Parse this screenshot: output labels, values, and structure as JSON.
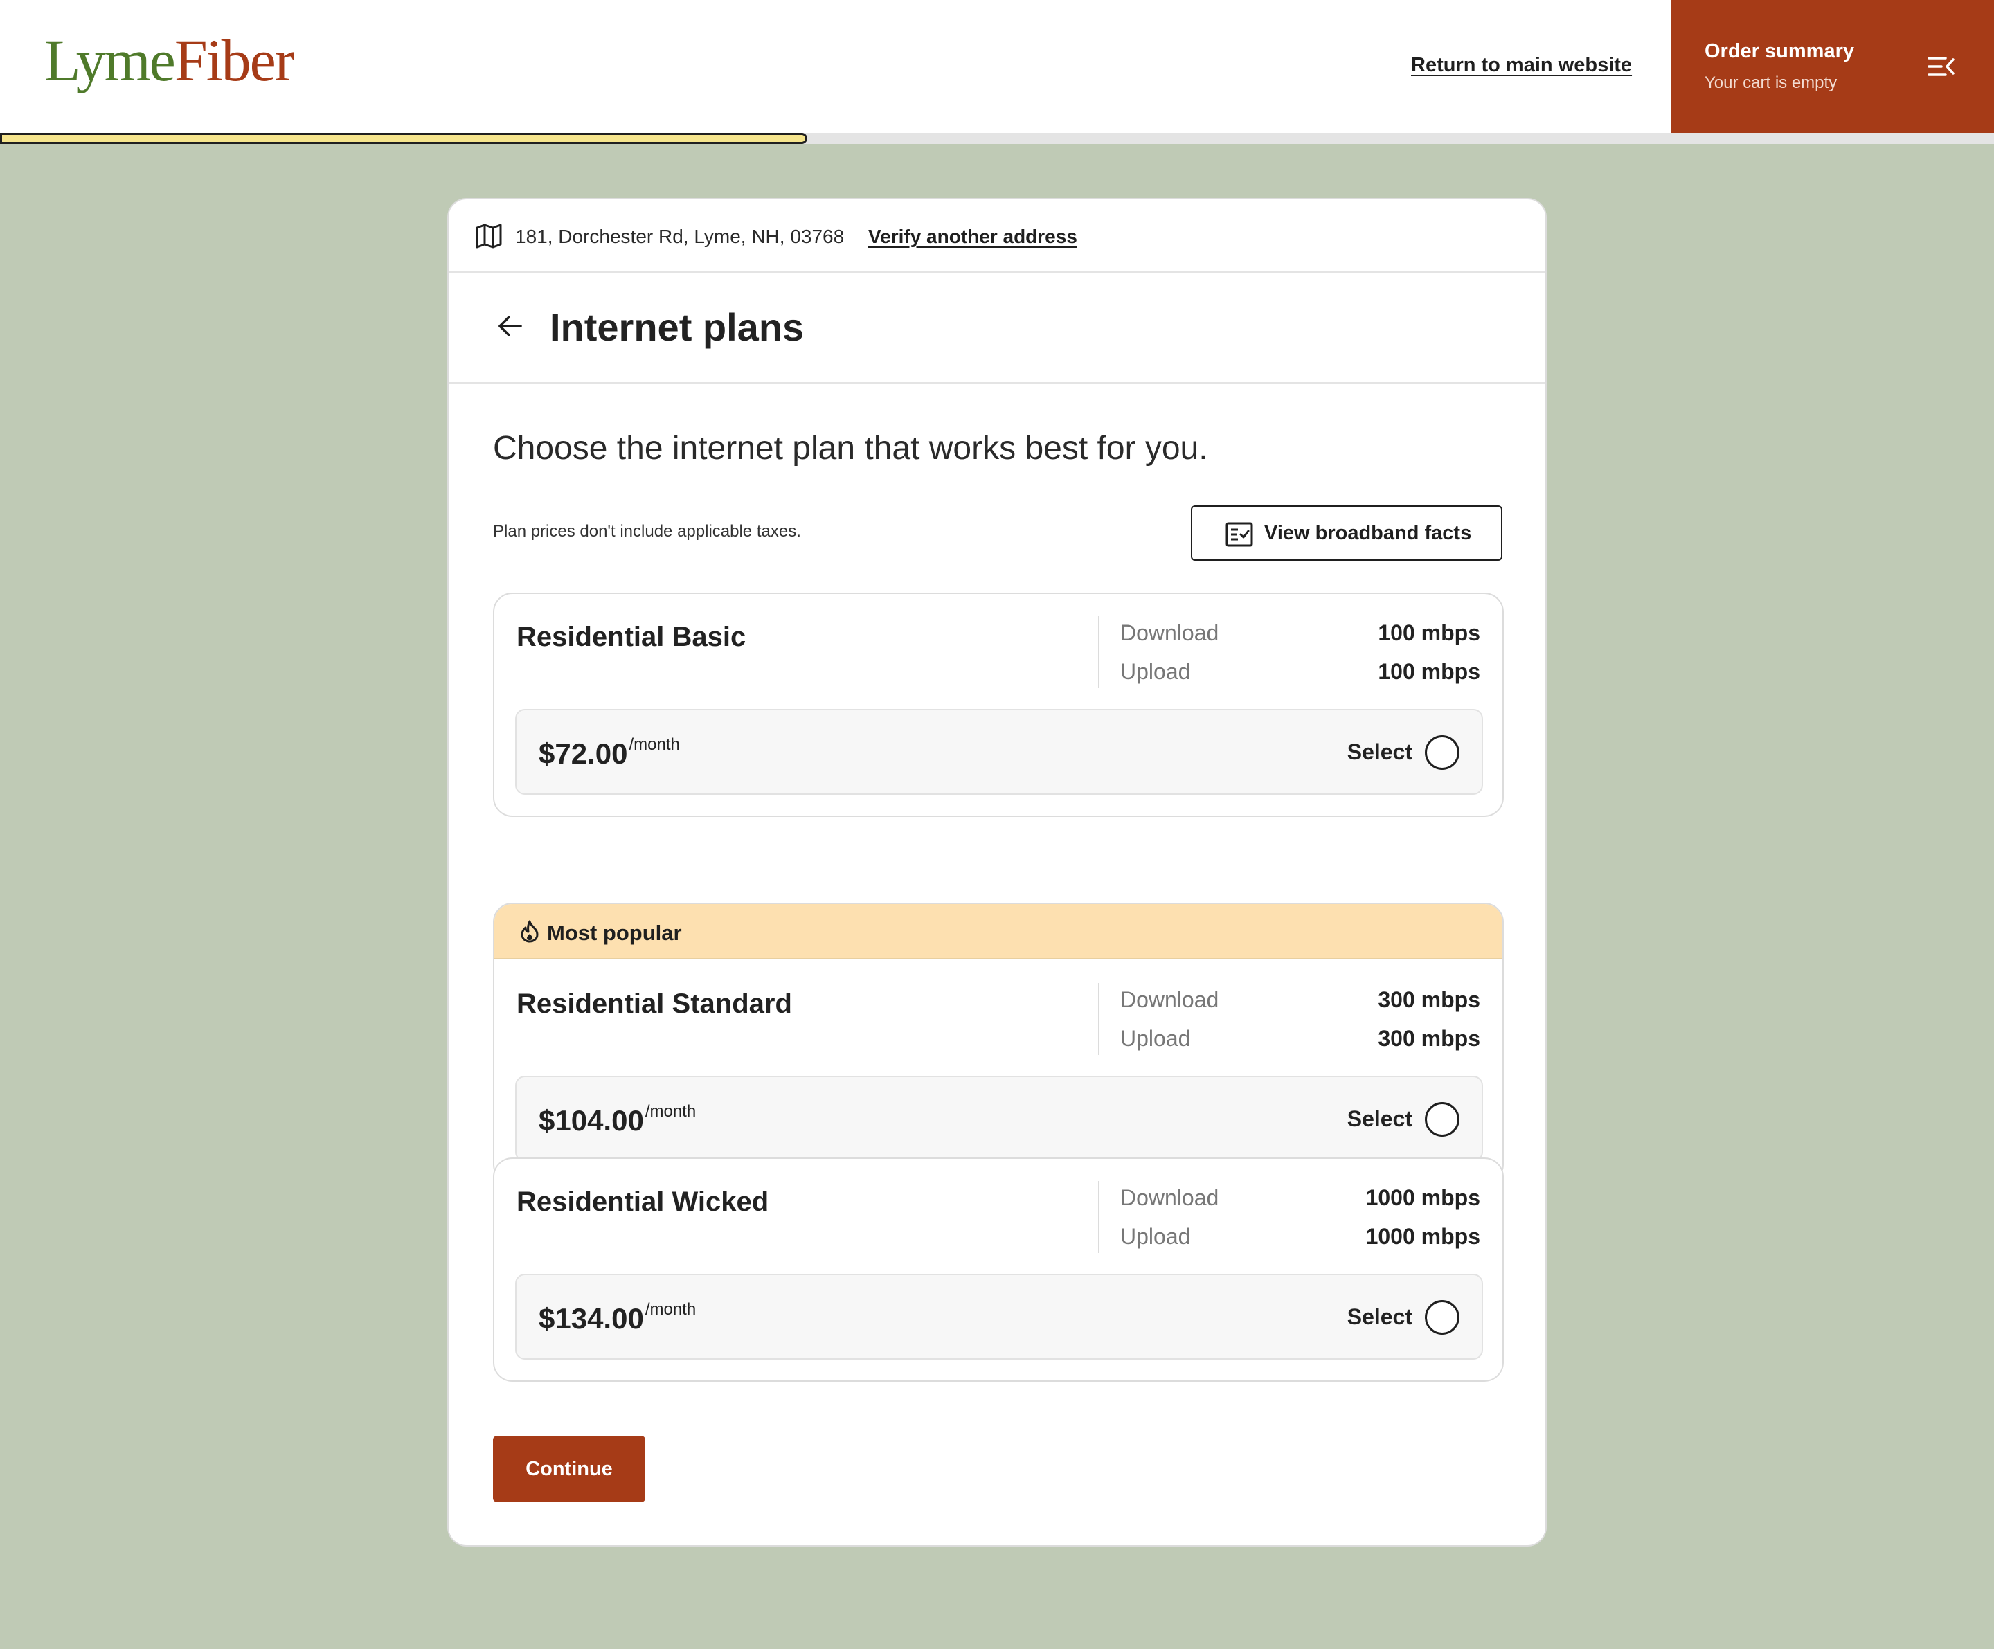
{
  "brand": {
    "logo_part1": "Lyme",
    "logo_part2": "Fiber"
  },
  "header": {
    "return_link": "Return to main website",
    "order_summary_title": "Order summary",
    "order_summary_status": "Your cart is empty",
    "menu_icon": "menu-collapse-icon"
  },
  "progress": {
    "fraction": 0.405
  },
  "colors": {
    "accent": "#a63b17",
    "brand_green": "#4f7a2a",
    "page_background": "#bfcab5",
    "progress_fill": "#f5e48c",
    "badge_background": "#fde0b0"
  },
  "address": {
    "icon": "map-icon",
    "text": "181, Dorchester Rd, Lyme, NH, 03768",
    "verify_link": "Verify another address"
  },
  "page": {
    "back_icon": "arrow-left-icon",
    "title": "Internet plans",
    "intro": "Choose the internet plan that works best for you.",
    "tax_note": "Plan prices don't include applicable taxes.",
    "facts_button": "View broadband facts",
    "facts_icon": "checklist-icon",
    "continue_button": "Continue"
  },
  "plans": [
    {
      "name": "Residential Basic",
      "badge": null,
      "download_label": "Download",
      "download": "100 mbps",
      "upload_label": "Upload",
      "upload": "100 mbps",
      "price": "$72.00",
      "per": "/month",
      "select_label": "Select",
      "selected": false
    },
    {
      "name": "Residential Standard",
      "badge": "Most popular",
      "badge_icon": "flame-icon",
      "download_label": "Download",
      "download": "300 mbps",
      "upload_label": "Upload",
      "upload": "300 mbps",
      "price": "$104.00",
      "per": "/month",
      "select_label": "Select",
      "selected": false
    },
    {
      "name": "Residential Wicked",
      "badge": null,
      "download_label": "Download",
      "download": "1000 mbps",
      "upload_label": "Upload",
      "upload": "1000 mbps",
      "price": "$134.00",
      "per": "/month",
      "select_label": "Select",
      "selected": false
    }
  ]
}
